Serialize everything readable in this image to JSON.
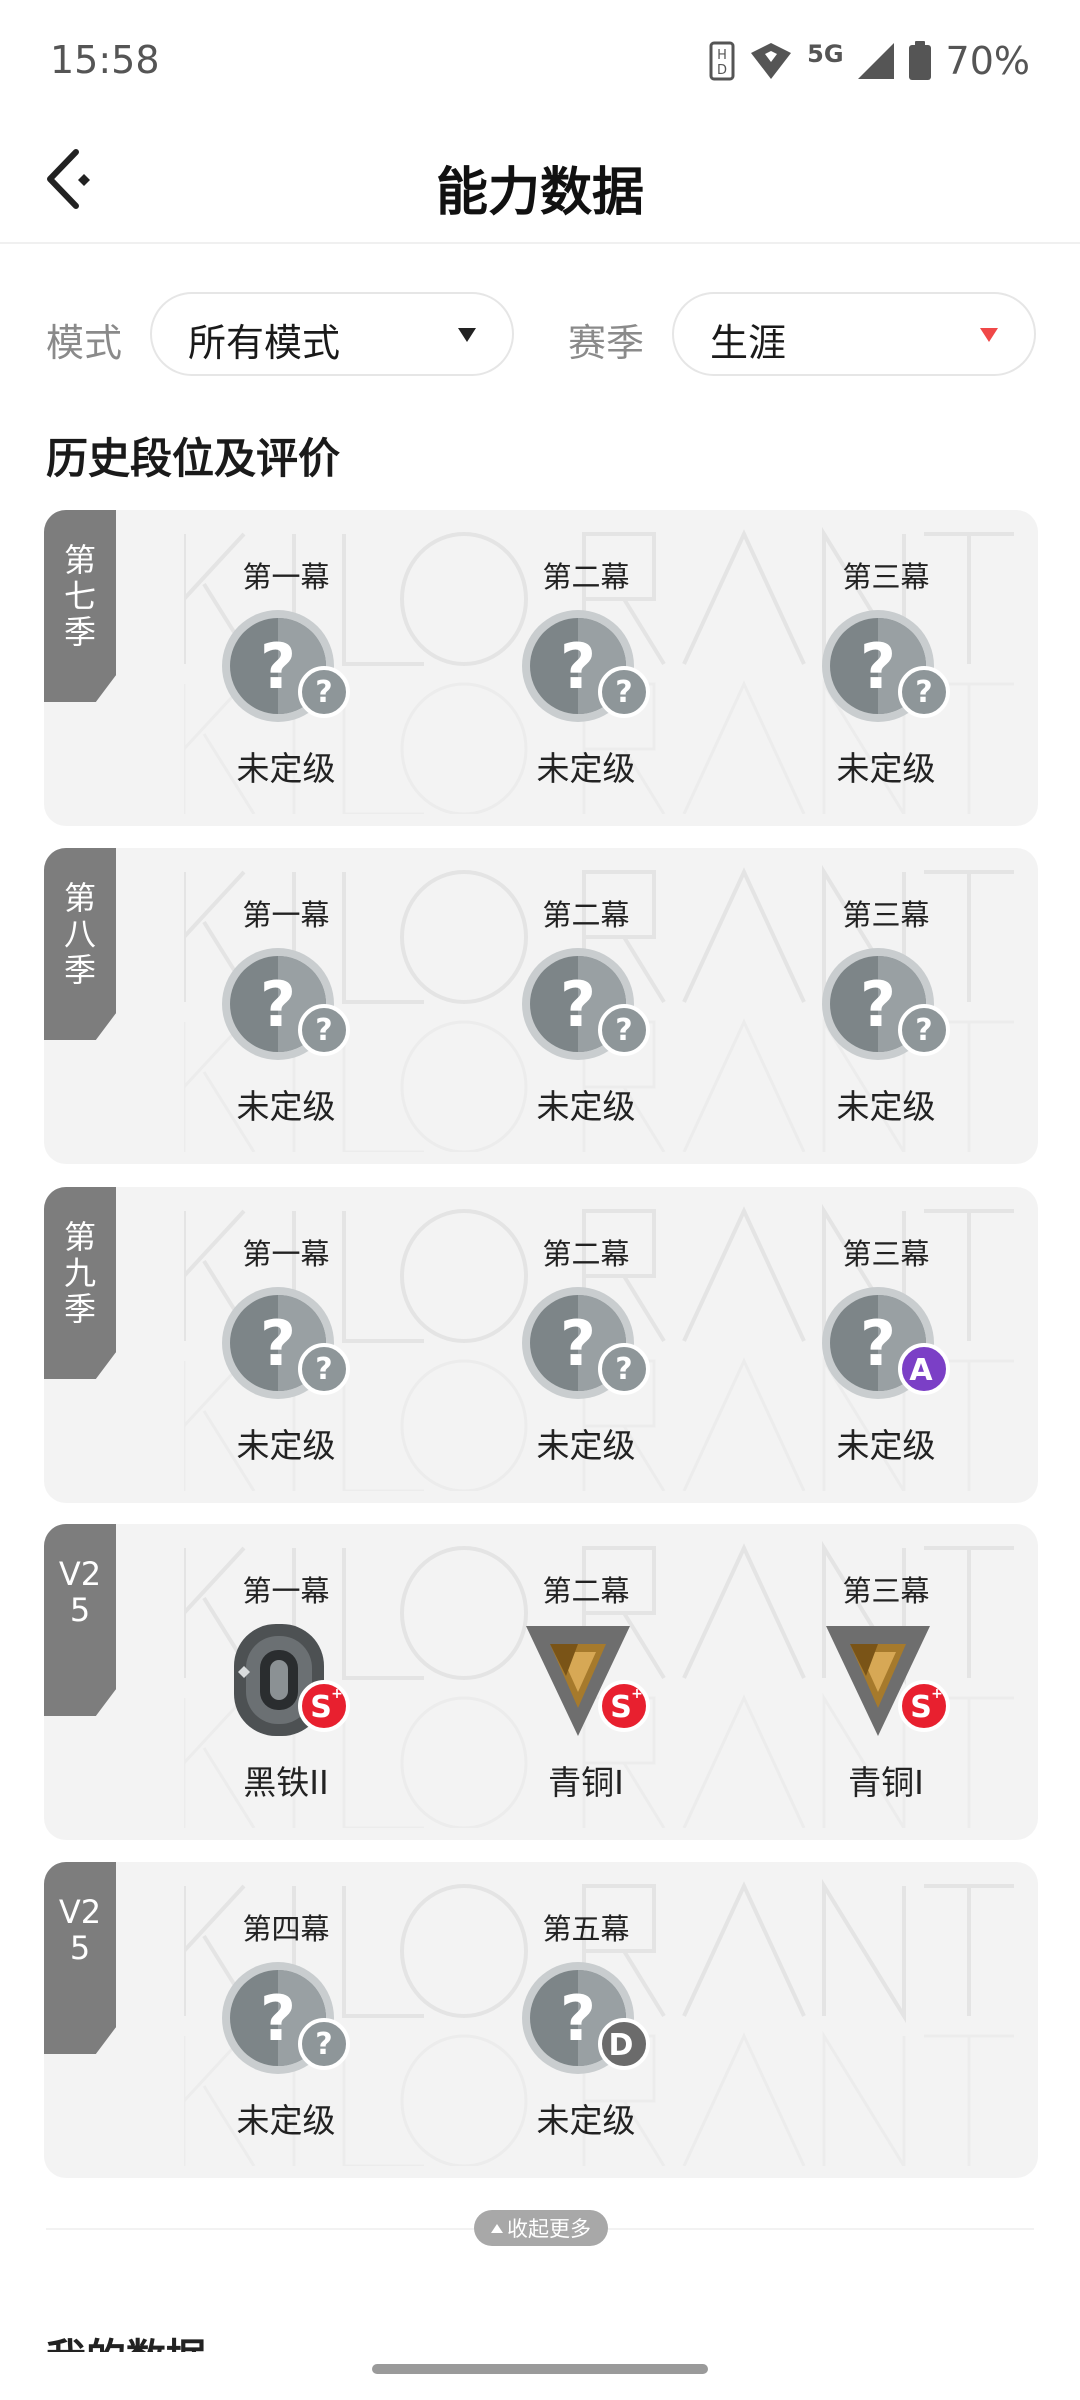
{
  "status_bar": {
    "time": "15:58",
    "network": "5G",
    "battery": "70%",
    "icons": [
      "hd-icon",
      "wifi-icon",
      "signal-icon",
      "battery-icon"
    ]
  },
  "header": {
    "title": "能力数据",
    "back_icon": "back-arrow-icon"
  },
  "filters": {
    "mode_label": "模式",
    "mode_value": "所有模式",
    "season_label": "赛季",
    "season_value": "生涯"
  },
  "section_title": "历史段位及评价",
  "colors": {
    "tag": "#7d7d7d",
    "card": "#f3f3f3",
    "caret_accent": "#f04848",
    "grade_s": "#e8202f",
    "grade_a": "#7b3fc6",
    "grade_d": "#6b6b6b"
  },
  "seasons": [
    {
      "tag": "第七季",
      "acts": [
        {
          "name": "第一幕",
          "rank": "未定级",
          "badge": "unranked-icon",
          "grade": "?"
        },
        {
          "name": "第二幕",
          "rank": "未定级",
          "badge": "unranked-icon",
          "grade": "?"
        },
        {
          "name": "第三幕",
          "rank": "未定级",
          "badge": "unranked-icon",
          "grade": "?"
        }
      ]
    },
    {
      "tag": "第八季",
      "acts": [
        {
          "name": "第一幕",
          "rank": "未定级",
          "badge": "unranked-icon",
          "grade": "?"
        },
        {
          "name": "第二幕",
          "rank": "未定级",
          "badge": "unranked-icon",
          "grade": "?"
        },
        {
          "name": "第三幕",
          "rank": "未定级",
          "badge": "unranked-icon",
          "grade": "?"
        }
      ]
    },
    {
      "tag": "第九季",
      "acts": [
        {
          "name": "第一幕",
          "rank": "未定级",
          "badge": "unranked-icon",
          "grade": "?"
        },
        {
          "name": "第二幕",
          "rank": "未定级",
          "badge": "unranked-icon",
          "grade": "?"
        },
        {
          "name": "第三幕",
          "rank": "未定级",
          "badge": "unranked-icon",
          "grade": "A"
        }
      ]
    },
    {
      "tag": "V25",
      "acts": [
        {
          "name": "第一幕",
          "rank": "黑铁II",
          "badge": "iron-rank-icon",
          "grade": "S+"
        },
        {
          "name": "第二幕",
          "rank": "青铜I",
          "badge": "bronze-rank-icon",
          "grade": "S+"
        },
        {
          "name": "第三幕",
          "rank": "青铜I",
          "badge": "bronze-rank-icon",
          "grade": "S+"
        }
      ]
    },
    {
      "tag": "V25",
      "acts": [
        {
          "name": "第四幕",
          "rank": "未定级",
          "badge": "unranked-icon",
          "grade": "?"
        },
        {
          "name": "第五幕",
          "rank": "未定级",
          "badge": "unranked-icon",
          "grade": "D"
        }
      ]
    }
  ],
  "collapse_label": "收起更多",
  "next_section_title": "我的数据"
}
